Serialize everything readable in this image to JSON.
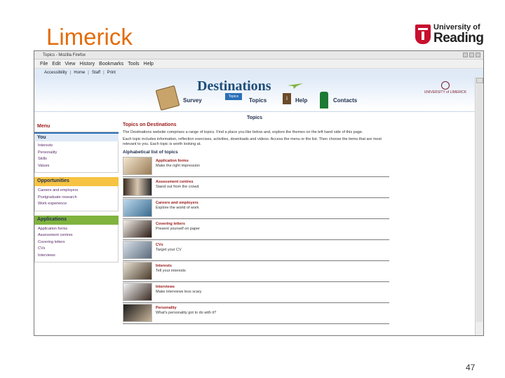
{
  "slide": {
    "title": "Limerick",
    "page_number": "47",
    "logo": {
      "line1": "University of",
      "line2": "Reading"
    }
  },
  "browser": {
    "window_title": "Topics - Mozilla Firefox",
    "menu": [
      "File",
      "Edit",
      "View",
      "History",
      "Bookmarks",
      "Tools",
      "Help"
    ],
    "site_links": [
      "Accessibility",
      "Home",
      "Staff",
      "Print"
    ]
  },
  "site": {
    "title": "Destinations",
    "partner_logo": "UNIVERSITY of LIMERICK",
    "nav": [
      {
        "label": "Survey",
        "icon": "clipboard-icon"
      },
      {
        "label": "Topics",
        "icon": "signpost-icon",
        "badge": "Topics"
      },
      {
        "label": "Help",
        "icon": "info-icon"
      },
      {
        "label": "Contacts",
        "icon": "postbox-icon"
      }
    ],
    "current_section": "Topics"
  },
  "sidebar": {
    "heading": "Menu",
    "groups": [
      {
        "label": "You",
        "color": "#dfeaf6",
        "links": [
          "Interests",
          "Personality",
          "Skills",
          "Values"
        ]
      },
      {
        "label": "Opportunities",
        "color": "#f6c342",
        "links": [
          "Careers and employers",
          "Postgraduate research",
          "Work experience"
        ]
      },
      {
        "label": "Applications",
        "color": "#7fb33e",
        "links": [
          "Application forms",
          "Assessment centres",
          "Covering letters",
          "CVs",
          "Interviews"
        ]
      }
    ]
  },
  "main": {
    "heading": "Topics on Destinations",
    "intro_1": "The Destinations website comprises a range of topics. Find a place you like below and, explore the themes on the left hand side of this page.",
    "intro_2": "Each topic includes information, reflection exercises, activities, downloads and videos. Access the menu or the list. Then choose the items that are most relevant to you. Each topic is worth looking at.",
    "list_heading": "Alphabetical list of topics",
    "topics": [
      {
        "title": "Application forms",
        "subtitle": "Make the right impression"
      },
      {
        "title": "Assessment centres",
        "subtitle": "Stand out from the crowd"
      },
      {
        "title": "Careers and employers",
        "subtitle": "Explore the world of work"
      },
      {
        "title": "Covering letters",
        "subtitle": "Present yourself on paper"
      },
      {
        "title": "CVs",
        "subtitle": "Target your CV"
      },
      {
        "title": "Interests",
        "subtitle": "Tell your interests"
      },
      {
        "title": "Interviews",
        "subtitle": "Make interviews less scary"
      },
      {
        "title": "Personality",
        "subtitle": "What's personality got to do with it?"
      }
    ]
  },
  "colors": {
    "slide_title": "#e36c0a",
    "topic_title": "#9a1a1a",
    "link": "#5a2a6b",
    "brand_blue": "#1f4e79"
  }
}
